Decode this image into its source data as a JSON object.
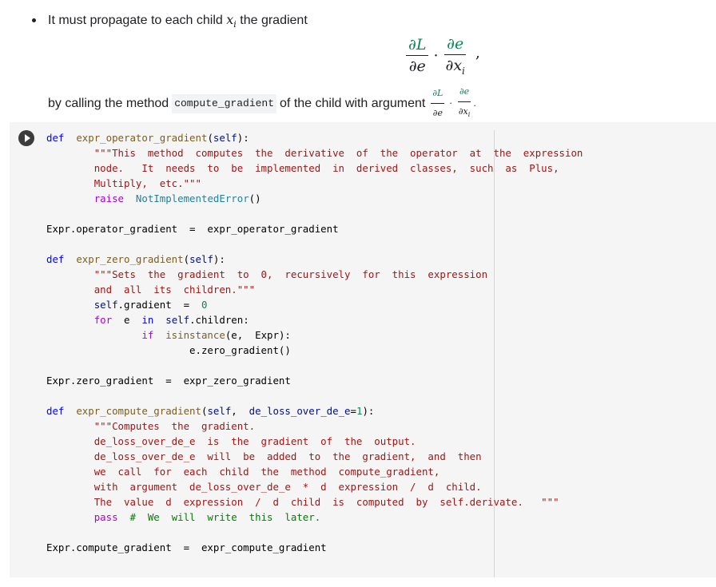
{
  "markdown": {
    "bullet_text_before": "It must propagate to each child ",
    "bullet_var": "x",
    "bullet_var_sub": "i",
    "bullet_text_after": " the gradient",
    "display_formula": {
      "num1": "∂L",
      "den1": "∂e",
      "dot": "·",
      "num2": "∂e",
      "den2": "∂x",
      "den2_sub": "i",
      "trailing": ","
    },
    "line2_before": "by calling the method",
    "line2_code": "compute_gradient",
    "line2_after": "of the child with argument",
    "inline_formula": {
      "num1": "∂L",
      "den1": "∂e",
      "dot": "·",
      "num2": "∂e",
      "den2": "∂x",
      "den2_sub": "i",
      "trailing": "."
    }
  },
  "code_cell": {
    "run_button_label": "Run cell",
    "lines": [
      [
        [
          "kw",
          "def"
        ],
        [
          "",
          "  "
        ],
        [
          "fn",
          "expr_operator_gradient"
        ],
        [
          "",
          "("
        ],
        [
          "par",
          "self"
        ],
        [
          "",
          "):"
        ]
      ],
      [
        [
          "",
          "        "
        ],
        [
          "str",
          "\"\"\"This  method  computes  the  derivative  of  the  operator  at  the  expression"
        ]
      ],
      [
        [
          "",
          "        "
        ],
        [
          "str",
          "node.   It  needs  to  be  implemented  in  derived  classes,  such  as  Plus,"
        ]
      ],
      [
        [
          "",
          "        "
        ],
        [
          "str",
          "Multiply,  etc.\"\"\""
        ]
      ],
      [
        [
          "",
          "        "
        ],
        [
          "ctl",
          "raise"
        ],
        [
          "",
          "  "
        ],
        [
          "cls",
          "NotImplementedError"
        ],
        [
          "",
          "()"
        ]
      ],
      [],
      [
        [
          "",
          "Expr.operator_gradient  =  expr_operator_gradient"
        ]
      ],
      [],
      [
        [
          "kw",
          "def"
        ],
        [
          "",
          "  "
        ],
        [
          "fn",
          "expr_zero_gradient"
        ],
        [
          "",
          "("
        ],
        [
          "par",
          "self"
        ],
        [
          "",
          "):"
        ]
      ],
      [
        [
          "",
          "        "
        ],
        [
          "str",
          "\"\"\"Sets  the  gradient  to  0,  recursively  for  this  expression"
        ]
      ],
      [
        [
          "",
          "        "
        ],
        [
          "str",
          "and  all  its  children.\"\"\""
        ]
      ],
      [
        [
          "",
          "        "
        ],
        [
          "par",
          "self"
        ],
        [
          "",
          ".gradient  =  "
        ],
        [
          "num",
          "0"
        ]
      ],
      [
        [
          "",
          "        "
        ],
        [
          "ctl",
          "for"
        ],
        [
          "",
          "  e  "
        ],
        [
          "kw",
          "in"
        ],
        [
          "",
          "  "
        ],
        [
          "par",
          "self"
        ],
        [
          "",
          ".children:"
        ]
      ],
      [
        [
          "",
          "                "
        ],
        [
          "ctl",
          "if"
        ],
        [
          "",
          "  "
        ],
        [
          "fn",
          "isinstance"
        ],
        [
          "",
          "(e,  Expr):"
        ]
      ],
      [
        [
          "",
          "                        e.zero_gradient()"
        ]
      ],
      [],
      [
        [
          "",
          "Expr.zero_gradient  =  expr_zero_gradient"
        ]
      ],
      [],
      [
        [
          "kw",
          "def"
        ],
        [
          "",
          "  "
        ],
        [
          "fn",
          "expr_compute_gradient"
        ],
        [
          "",
          "("
        ],
        [
          "par",
          "self"
        ],
        [
          "",
          ",  "
        ],
        [
          "par",
          "de_loss_over_de_e"
        ],
        [
          "",
          "="
        ],
        [
          "num",
          "1"
        ],
        [
          "",
          "):"
        ]
      ],
      [
        [
          "",
          "        "
        ],
        [
          "str",
          "\"\"\"Computes  the  gradient."
        ]
      ],
      [
        [
          "",
          "        "
        ],
        [
          "str",
          "de_loss_over_de_e  is  the  gradient  of  the  output."
        ]
      ],
      [
        [
          "",
          "        "
        ],
        [
          "str",
          "de_loss_over_de_e  will  be  added  to  the  gradient,  and  then"
        ]
      ],
      [
        [
          "",
          "        "
        ],
        [
          "str",
          "we  call  for  each  child  the  method  compute_gradient,"
        ]
      ],
      [
        [
          "",
          "        "
        ],
        [
          "str",
          "with  argument  de_loss_over_de_e  *  d  expression  /  d  child."
        ]
      ],
      [
        [
          "",
          "        "
        ],
        [
          "str",
          "The  value  d  expression  /  d  child  is  computed  by  self.derivate.   \"\"\""
        ]
      ],
      [
        [
          "",
          "        "
        ],
        [
          "ctl",
          "pass"
        ],
        [
          "",
          "  "
        ],
        [
          "com",
          "#  We  will  write  this  later."
        ]
      ],
      [],
      [
        [
          "",
          "Expr.compute_gradient  =  expr_compute_gradient"
        ]
      ]
    ]
  }
}
